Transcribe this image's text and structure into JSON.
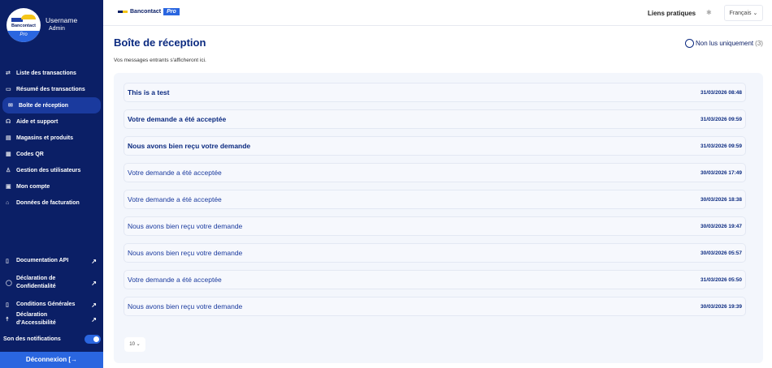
{
  "user": {
    "name": "Username",
    "role": "Admin",
    "logo_text": "Bancontact",
    "logo_badge": "Pro"
  },
  "nav": [
    {
      "label": "Liste des transactions",
      "icon": "⇄"
    },
    {
      "label": "Résumé des transactions",
      "icon": "▭"
    },
    {
      "label": "Boîte de réception",
      "icon": "✉",
      "active": true
    },
    {
      "label": "Aide et support",
      "icon": "☊"
    },
    {
      "label": "Magasins et produits",
      "icon": "▤"
    },
    {
      "label": "Codes QR",
      "icon": "▦"
    },
    {
      "label": "Gestion des utilisateurs",
      "icon": "♙"
    },
    {
      "label": "Mon compte",
      "icon": "▣"
    },
    {
      "label": "Données de facturation",
      "icon": "⌂"
    }
  ],
  "bottom_links": [
    {
      "label": "Documentation API",
      "icon": "▯"
    },
    {
      "label": "Déclaration de Confidentialité",
      "icon": "◯"
    },
    {
      "label": "Conditions Générales",
      "icon": "▯"
    },
    {
      "label": "Déclaration d'Accessibilité",
      "icon": "☨"
    }
  ],
  "notifications_label": "Son des notifications",
  "notifications_on": true,
  "logout_label": "Déconnexion",
  "topbar": {
    "brand": "Bancontact",
    "badge": "Pro",
    "links": "Liens pratiques",
    "language": "Français"
  },
  "page": {
    "title": "Boîte de réception",
    "subtitle": "Vos messages entrants s'afficheront ici.",
    "unread_label": "Non lus uniquement",
    "unread_count": "(3)"
  },
  "messages": [
    {
      "subject": "This is a test",
      "date": "31/03/2026 08:48",
      "unread": true
    },
    {
      "subject": "Votre demande a été acceptée",
      "date": "31/03/2026 09:59",
      "unread": true
    },
    {
      "subject": "Nous avons bien reçu votre demande",
      "date": "31/03/2026 09:59",
      "unread": true
    },
    {
      "subject": "Votre demande a été acceptée",
      "date": "30/03/2026 17:49",
      "unread": false
    },
    {
      "subject": "Votre demande a été acceptée",
      "date": "30/03/2026 18:38",
      "unread": false
    },
    {
      "subject": "Nous avons bien reçu votre demande",
      "date": "30/03/2026 19:47",
      "unread": false
    },
    {
      "subject": "Nous avons bien reçu votre demande",
      "date": "30/03/2026 05:57",
      "unread": false
    },
    {
      "subject": "Votre demande a été acceptée",
      "date": "31/03/2026 05:50",
      "unread": false
    },
    {
      "subject": "Nous avons bien reçu votre demande",
      "date": "30/03/2026 19:39",
      "unread": false
    }
  ],
  "page_size": "10"
}
